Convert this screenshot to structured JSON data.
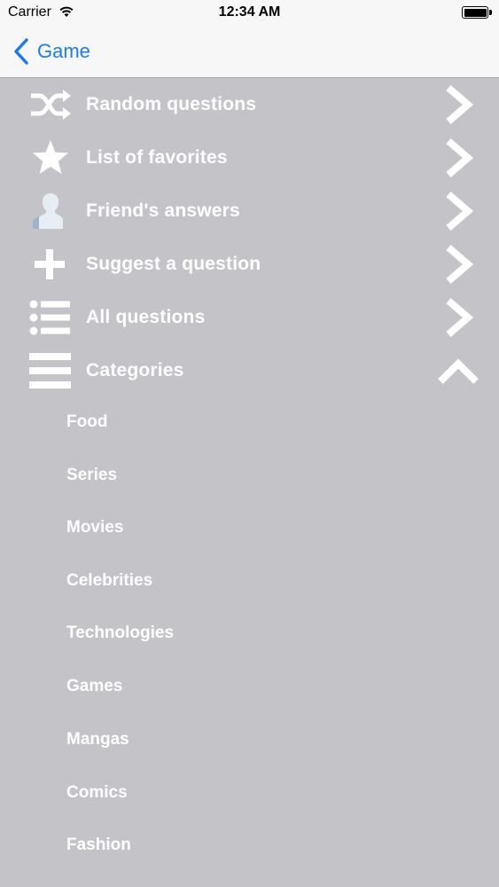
{
  "status_bar": {
    "carrier": "Carrier",
    "time": "12:34 AM"
  },
  "nav": {
    "back_label": "Game"
  },
  "menu": [
    {
      "label": "Random questions",
      "icon": "shuffle-icon"
    },
    {
      "label": "List of favorites",
      "icon": "star-icon"
    },
    {
      "label": "Friend's answers",
      "icon": "person-icon"
    },
    {
      "label": "Suggest a question",
      "icon": "plus-icon"
    },
    {
      "label": "All questions",
      "icon": "list-icon"
    },
    {
      "label": "Categories",
      "icon": "menu-icon",
      "expanded": true
    }
  ],
  "categories": [
    "Food",
    "Series",
    "Movies",
    "Celebrities",
    "Technologies",
    "Games",
    "Mangas",
    "Comics",
    "Fashion"
  ],
  "colors": {
    "background": "#c4c3c7",
    "accent": "#1a7cf5",
    "text": "#ffffff",
    "header": "#f7f7f7"
  }
}
